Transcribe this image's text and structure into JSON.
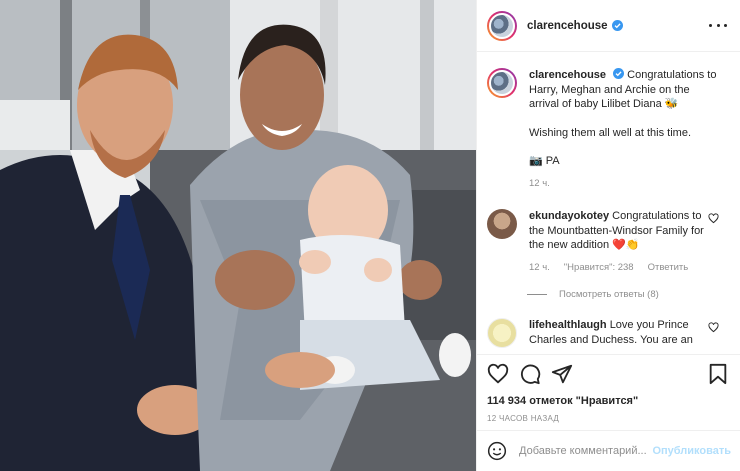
{
  "post": {
    "photo_alt": "",
    "header": {
      "username": "clarencehouse",
      "verified": true
    },
    "caption": {
      "username": "clarencehouse",
      "text": "Congratulations to Harry, Meghan and Archie on the arrival of baby Lilibet Diana",
      "emoji": "🐝",
      "line2": "Wishing them all well at this time.",
      "line3_emoji": "📷",
      "line3": "PA",
      "time": "12 ч."
    },
    "comments": [
      {
        "username": "ekundayokotey",
        "text": "Congratulations to the Mountbatten-Windsor Family for the new addition",
        "emoji": "❤️👏",
        "time": "12 ч.",
        "likes": "\"Нравится\": 238",
        "reply": "Ответить",
        "view_replies": "Посмотреть ответы (8)"
      },
      {
        "username": "lifehealthlaugh",
        "text": "Love you Prince Charles and Duchess. You are an"
      }
    ],
    "likes_text": "114 934 отметок \"Нравится\"",
    "time_ago": "12 ЧАСОВ НАЗАД",
    "add_comment": {
      "placeholder": "Добавьте комментарий...",
      "publish": "Опубликовать"
    }
  },
  "colors": {
    "verified": "#3897f0",
    "link": "#b2dffc",
    "muted": "#8e8e8e"
  },
  "icons": [
    "more-icon",
    "verified-icon",
    "heart-icon",
    "comment-icon",
    "share-icon",
    "bookmark-icon",
    "emoji-icon"
  ]
}
